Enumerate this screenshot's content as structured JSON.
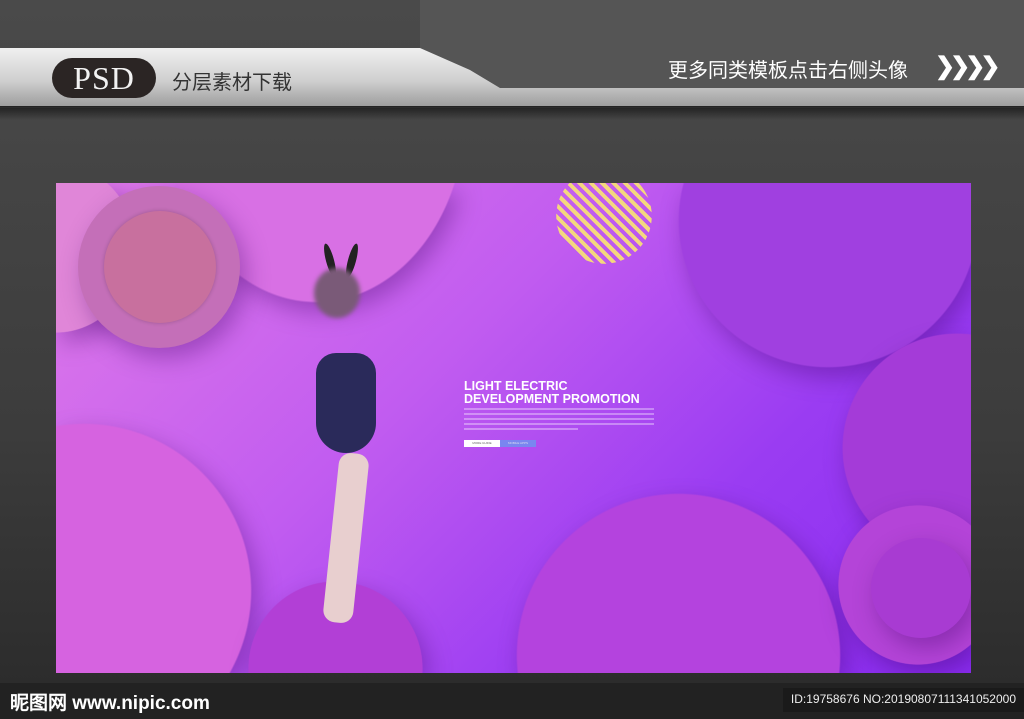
{
  "header": {
    "badge": "PSD",
    "subtitle": "分层素材下载",
    "more_text": "更多同类模板点击右侧头像",
    "arrows": "❯❯❯❯"
  },
  "poster": {
    "title_line1": "LIGHT ELECTRIC",
    "title_line2": "DEVELOPMENT PROMOTION",
    "button1": "MORE GUIDE",
    "button2": "MOBILE APPS"
  },
  "footer": {
    "logo": "昵图网 www.nipic.com",
    "id_text": "ID:19758676 NO:20190807111341052000"
  }
}
